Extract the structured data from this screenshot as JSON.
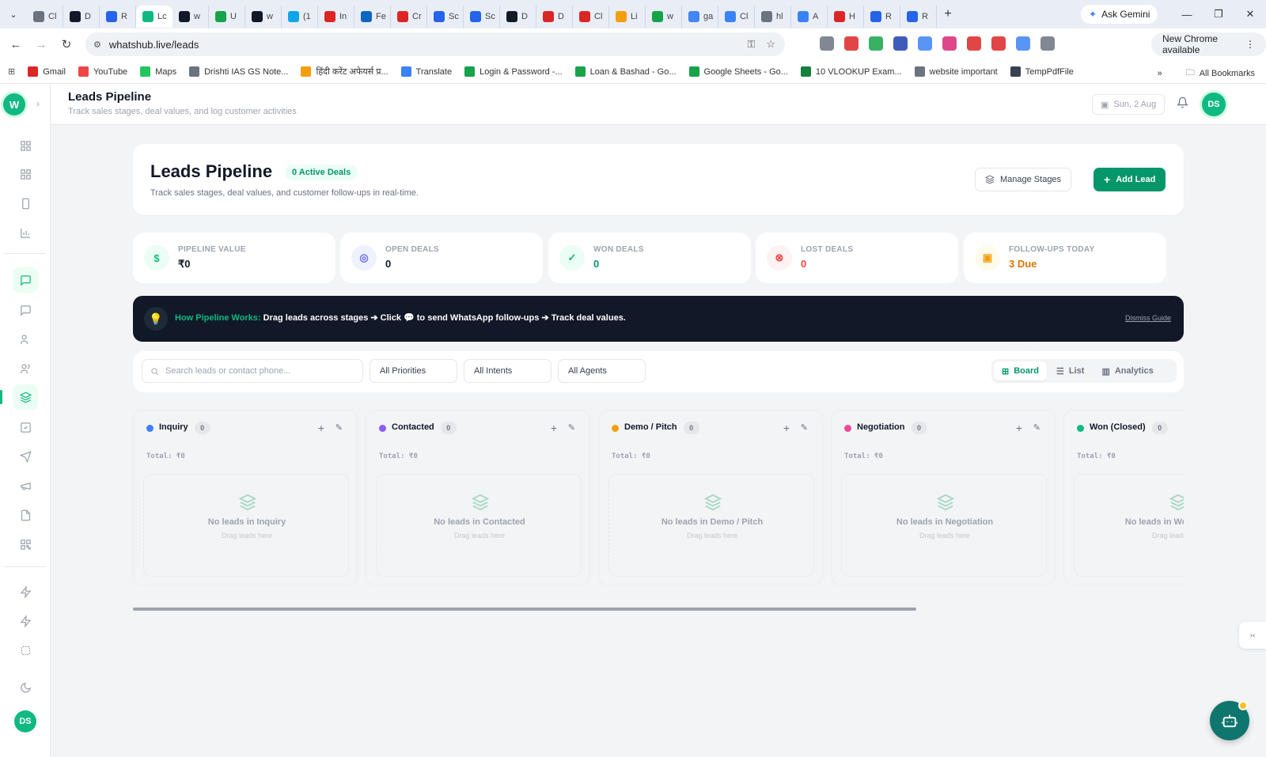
{
  "browser": {
    "tabs": [
      {
        "label": "Cl",
        "color": "#6b7280"
      },
      {
        "label": "D",
        "color": "#111827"
      },
      {
        "label": "R",
        "color": "#2563eb"
      },
      {
        "label": "Lc",
        "color": "#10b981",
        "active": true
      },
      {
        "label": "w",
        "color": "#111827"
      },
      {
        "label": "U",
        "color": "#16a34a"
      },
      {
        "label": "w",
        "color": "#111827"
      },
      {
        "label": "(1",
        "color": "#0ea5e9"
      },
      {
        "label": "In",
        "color": "#dc2626"
      },
      {
        "label": "Fe",
        "color": "#0a66c2"
      },
      {
        "label": "Cr",
        "color": "#dc2626"
      },
      {
        "label": "Sc",
        "color": "#2563eb"
      },
      {
        "label": "Sc",
        "color": "#2563eb"
      },
      {
        "label": "D",
        "color": "#111827"
      },
      {
        "label": "D",
        "color": "#dc2626"
      },
      {
        "label": "Cl",
        "color": "#dc2626"
      },
      {
        "label": "Li",
        "color": "#f59e0b"
      },
      {
        "label": "w",
        "color": "#16a34a"
      },
      {
        "label": "ga",
        "color": "#4285f4"
      },
      {
        "label": "Cl",
        "color": "#3b82f6"
      },
      {
        "label": "hl",
        "color": "#6b7280"
      },
      {
        "label": "A",
        "color": "#3b82f6"
      },
      {
        "label": "H",
        "color": "#dc2626"
      },
      {
        "label": "R",
        "color": "#2563eb"
      },
      {
        "label": "R",
        "color": "#2563eb"
      }
    ],
    "close_glyph": "✕",
    "newtab_glyph": "+",
    "gemini_label": "Ask Gemini",
    "url": "whatshub.live/leads",
    "new_chrome_label": "New Chrome available",
    "bookmarks": [
      {
        "label": "Gmail",
        "color": "#dc2626"
      },
      {
        "label": "YouTube",
        "color": "#ef4444"
      },
      {
        "label": "Maps",
        "color": "#22c55e"
      },
      {
        "label": "Drishti IAS GS Note...",
        "color": "#6b7280"
      },
      {
        "label": "हिंदी करेंट अफेयर्स प्र...",
        "color": "#f59e0b"
      },
      {
        "label": "Translate",
        "color": "#3b82f6"
      },
      {
        "label": "Login & Password -...",
        "color": "#16a34a"
      },
      {
        "label": "Loan & Bashad - Go...",
        "color": "#16a34a"
      },
      {
        "label": "Google Sheets - Go...",
        "color": "#16a34a"
      },
      {
        "label": "10 VLOOKUP Exam...",
        "color": "#15803d"
      },
      {
        "label": "website important",
        "color": "#6b7280"
      },
      {
        "label": "TempPdfFile",
        "color": "#374151"
      }
    ],
    "more_glyph": "»",
    "all_bookmarks": "All Bookmarks",
    "ext_colors": [
      "#6b7280",
      "#dc2626",
      "#16a34a",
      "#1e40af",
      "#3b82f6",
      "#db2777",
      "#dc2626",
      "#dc2626",
      "#3b82f6",
      "#6b7280"
    ]
  },
  "sidebar": {
    "logo": "W",
    "expand_glyph": "›",
    "avatar": "DS"
  },
  "header": {
    "title": "Leads Pipeline",
    "subtitle": "Track sales stages, deal values, and log customer activities",
    "date": "Sun, 2 Aug",
    "avatar": "DS"
  },
  "hero": {
    "title": "Leads Pipeline",
    "badge": "0 Active Deals",
    "subtitle": "Track sales stages, deal values, and customer follow-ups in real-time.",
    "manage_label": "Manage Stages",
    "add_label": "Add Lead",
    "add_glyph": "+"
  },
  "stats": [
    {
      "label": "PIPELINE VALUE",
      "value": "₹0",
      "icon": "dollar-icon",
      "glyph": "$",
      "color": "#10b981",
      "bg": "#ecfdf5",
      "valcolor": "#111827"
    },
    {
      "label": "OPEN DEALS",
      "value": "0",
      "icon": "target-icon",
      "glyph": "◎",
      "color": "#6366f1",
      "bg": "#eef2ff",
      "valcolor": "#111827"
    },
    {
      "label": "WON DEALS",
      "value": "0",
      "icon": "check-circle-icon",
      "glyph": "✓",
      "color": "#10b981",
      "bg": "#ecfdf5",
      "valcolor": "#059669"
    },
    {
      "label": "LOST DEALS",
      "value": "0",
      "icon": "x-circle-icon",
      "glyph": "⊗",
      "color": "#ef4444",
      "bg": "#fef2f2",
      "valcolor": "#ef4444"
    },
    {
      "label": "FOLLOW-UPS TODAY",
      "value": "3 Due",
      "icon": "calendar-icon",
      "glyph": "▣",
      "color": "#f59e0b",
      "bg": "#fffbeb",
      "valcolor": "#d97706"
    }
  ],
  "guide": {
    "lead": "How Pipeline Works:",
    "text": "Drag leads across stages ➔ Click 💬 to send WhatsApp follow-ups ➔ Track deal values.",
    "dismiss": "Dismiss Guide",
    "bulb_glyph": "💡"
  },
  "filters": {
    "search_placeholder": "Search leads or contact phone...",
    "priority": "All Priorities",
    "intent": "All Intents",
    "agent": "All Agents",
    "views": [
      {
        "label": "Board",
        "icon": "grid-icon",
        "active": true
      },
      {
        "label": "List",
        "icon": "list-icon",
        "active": false
      },
      {
        "label": "Analytics",
        "icon": "bar-chart-icon",
        "active": false
      }
    ]
  },
  "columns": [
    {
      "name": "Inquiry",
      "count": "0",
      "color": "#3b82f6",
      "total": "Total: ₹0",
      "empty": "No leads in Inquiry",
      "hint": "Drag leads here"
    },
    {
      "name": "Contacted",
      "count": "0",
      "color": "#8b5cf6",
      "total": "Total: ₹0",
      "empty": "No leads in Contacted",
      "hint": "Drag leads here"
    },
    {
      "name": "Demo / Pitch",
      "count": "0",
      "color": "#f59e0b",
      "total": "Total: ₹0",
      "empty": "No leads in Demo / Pitch",
      "hint": "Drag leads here"
    },
    {
      "name": "Negotiation",
      "count": "0",
      "color": "#ec4899",
      "total": "Total: ₹0",
      "empty": "No leads in Negotiation",
      "hint": "Drag leads here"
    },
    {
      "name": "Won (Closed)",
      "count": "0",
      "color": "#10b981",
      "total": "Total: ₹0",
      "empty": "No leads in Won (Closed)",
      "hint": "Drag leads here"
    }
  ],
  "column_plus_glyph": "+",
  "column_edit_glyph": "✎",
  "devtab_glyph": "›‹"
}
